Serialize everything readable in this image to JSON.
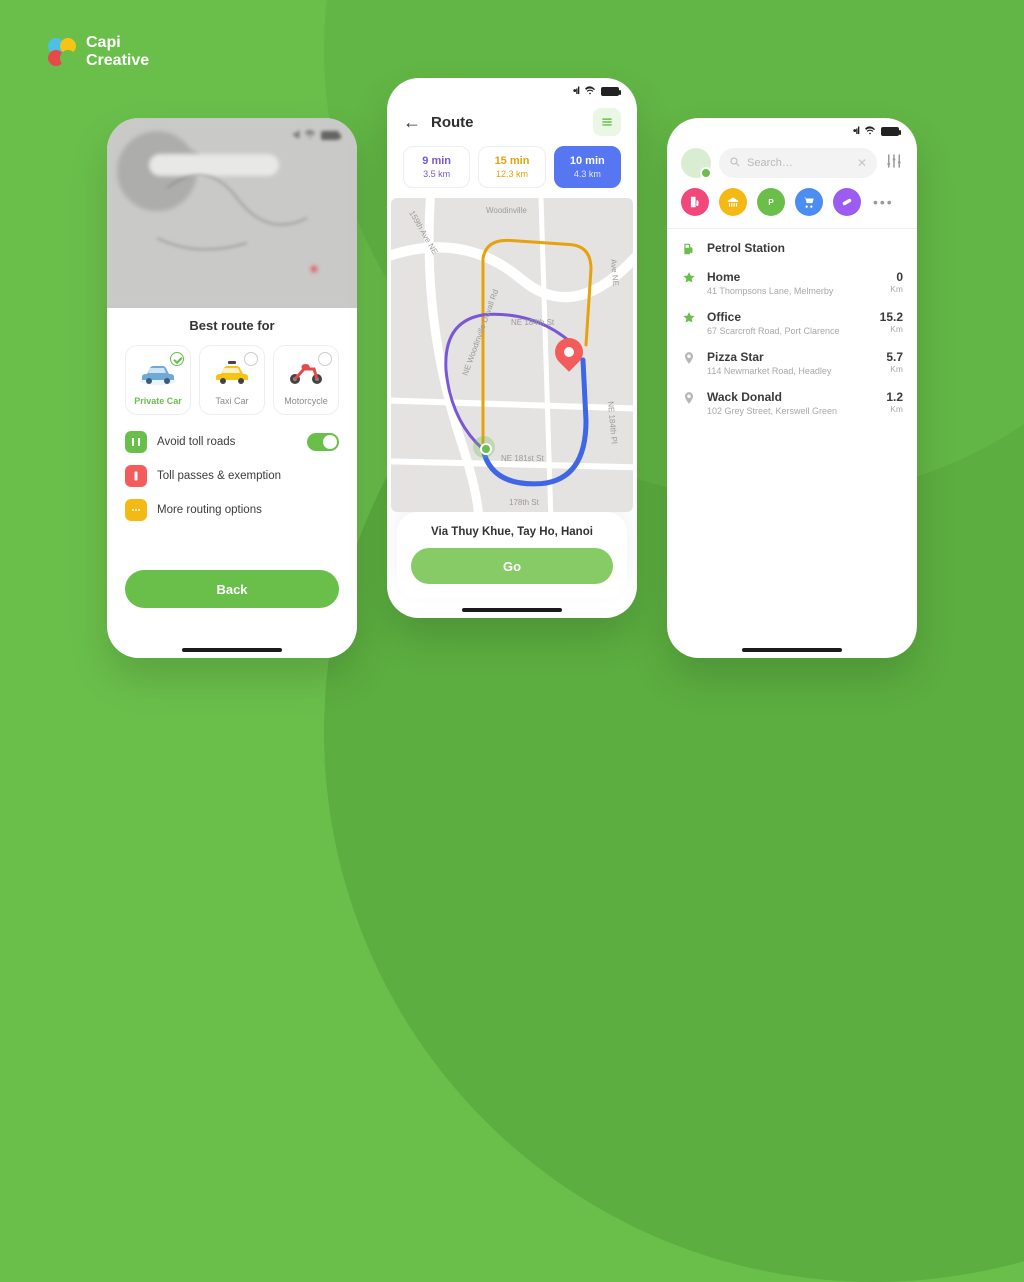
{
  "brand": {
    "line1": "Capi",
    "line2": "Creative"
  },
  "left_phone": {
    "sheet_title": "Best route for",
    "vehicles": [
      {
        "label": "Private Car"
      },
      {
        "label": "Taxi Car"
      },
      {
        "label": "Motorcycle"
      }
    ],
    "options": {
      "avoid_toll": "Avoid toll roads",
      "toll_passes": "Toll passes & exemption",
      "more": "More routing options"
    },
    "back_button": "Back"
  },
  "center_phone": {
    "header_title": "Route",
    "pills": [
      {
        "time": "9 min",
        "dist": "3.5 km",
        "color": "purple"
      },
      {
        "time": "15 min",
        "dist": "12.3 km",
        "color": "yellow"
      },
      {
        "time": "10 min",
        "dist": "4.3 km",
        "color": "blue"
      }
    ],
    "road_labels": {
      "woodinville": "NE Woodinville Duvall Rd",
      "r1": "NE 184th St",
      "r2": "NE 181st St",
      "r3": "178th St",
      "r4": "Woodinville",
      "r5": "159th Ave NE",
      "r6": "Ave NE",
      "r7": "NE 184th Pl"
    },
    "address": "Via Thuy Khue, Tay Ho, Hanoi",
    "go_button": "Go"
  },
  "right_phone": {
    "search_placeholder": "Search…",
    "section_header": "Petrol Station",
    "places": [
      {
        "name": "Home",
        "sub": "41 Thompsons Lane, Melmerby",
        "dist": "0",
        "unit": "Km",
        "fav": true
      },
      {
        "name": "Office",
        "sub": "67 Scarcroft Road, Port Clarence",
        "dist": "15.2",
        "unit": "Km",
        "fav": true
      },
      {
        "name": "Pizza Star",
        "sub": "114 Newmarket Road, Headley",
        "dist": "5.7",
        "unit": "Km",
        "fav": false
      },
      {
        "name": "Wack Donald",
        "sub": "102 Grey Street, Kerswell Green",
        "dist": "1.2",
        "unit": "Km",
        "fav": false
      }
    ]
  }
}
